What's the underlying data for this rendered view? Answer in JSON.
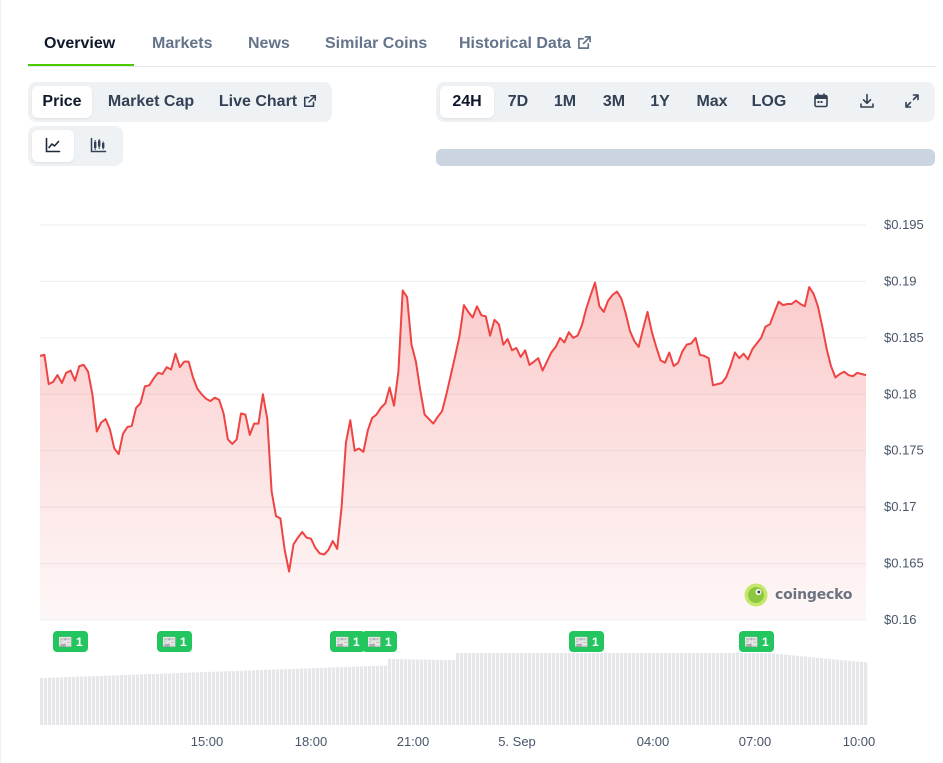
{
  "tabs": [
    {
      "label": "Overview",
      "active": true
    },
    {
      "label": "Markets"
    },
    {
      "label": "News"
    },
    {
      "label": "Similar Coins"
    },
    {
      "label": "Historical Data",
      "external": true
    }
  ],
  "chart_mode": [
    "Price",
    "Market Cap",
    "Live Chart"
  ],
  "chart_mode_active": "Price",
  "chart_style_icons": [
    "line-chart-icon",
    "candlestick-icon"
  ],
  "ranges": [
    "24H",
    "7D",
    "1M",
    "3M",
    "1Y",
    "Max",
    "LOG"
  ],
  "range_active": "24H",
  "tool_icons": [
    "calendar-icon",
    "download-icon",
    "fullscreen-icon"
  ],
  "watermark": "coingecko",
  "news_badge_count": "1",
  "colors": {
    "accent": "#4bcc00",
    "line": "#ef4444",
    "news": "#22c55e"
  },
  "chart_data": {
    "type": "area",
    "y_axis_ticks": [
      "$0.195",
      "$0.19",
      "$0.185",
      "$0.18",
      "$0.175",
      "$0.17",
      "$0.165",
      "$0.16"
    ],
    "ylim": [
      0.16,
      0.195
    ],
    "x_axis_ticks": [
      "15:00",
      "18:00",
      "21:00",
      "5. Sep",
      "04:00",
      "07:00",
      "10:00"
    ],
    "series": [
      {
        "values": [
          0.1834,
          0.1835,
          0.1809,
          0.1811,
          0.1817,
          0.181,
          0.1819,
          0.1821,
          0.1812,
          0.1825,
          0.1826,
          0.182,
          0.18,
          0.1767,
          0.1775,
          0.1778,
          0.1769,
          0.1752,
          0.1747,
          0.1765,
          0.1771,
          0.1772,
          0.1788,
          0.1792,
          0.1807,
          0.1808,
          0.1814,
          0.1819,
          0.1818,
          0.1824,
          0.1822,
          0.1836,
          0.1824,
          0.1829,
          0.1829,
          0.1815,
          0.1805,
          0.18,
          0.1796,
          0.1794,
          0.1797,
          0.1795,
          0.1783,
          0.176,
          0.1756,
          0.176,
          0.1783,
          0.1782,
          0.1764,
          0.1774,
          0.1774,
          0.18,
          0.1778,
          0.1714,
          0.1692,
          0.169,
          0.1662,
          0.1643,
          0.1667,
          0.1673,
          0.1678,
          0.1673,
          0.1672,
          0.1664,
          0.1659,
          0.1658,
          0.1662,
          0.167,
          0.1663,
          0.17,
          0.1757,
          0.1777,
          0.175,
          0.1752,
          0.1749,
          0.1768,
          0.1779,
          0.1782,
          0.1788,
          0.1792,
          0.1806,
          0.179,
          0.182,
          0.1892,
          0.1886,
          0.1844,
          0.1829,
          0.1804,
          0.1782,
          0.1778,
          0.1774,
          0.178,
          0.1785,
          0.18,
          0.1817,
          0.1834,
          0.1852,
          0.1879,
          0.1873,
          0.1868,
          0.1878,
          0.187,
          0.1869,
          0.1852,
          0.1866,
          0.1862,
          0.1844,
          0.1849,
          0.1839,
          0.1841,
          0.1833,
          0.1839,
          0.1826,
          0.1829,
          0.1832,
          0.1821,
          0.1829,
          0.1837,
          0.1842,
          0.185,
          0.1846,
          0.1855,
          0.185,
          0.1852,
          0.1861,
          0.1876,
          0.1888,
          0.1899,
          0.1878,
          0.1873,
          0.1883,
          0.1888,
          0.1891,
          0.1885,
          0.1872,
          0.1856,
          0.1847,
          0.1842,
          0.1858,
          0.1873,
          0.1855,
          0.1842,
          0.183,
          0.1828,
          0.1837,
          0.1825,
          0.1828,
          0.1838,
          0.1844,
          0.1845,
          0.185,
          0.1835,
          0.1834,
          0.1832,
          0.1808,
          0.1809,
          0.181,
          0.1815,
          0.1825,
          0.1837,
          0.1832,
          0.1836,
          0.1831,
          0.184,
          0.1845,
          0.185,
          0.186,
          0.1862,
          0.1872,
          0.1882,
          0.1879,
          0.188,
          0.188,
          0.1883,
          0.188,
          0.1878,
          0.1895,
          0.1889,
          0.1878,
          0.186,
          0.184,
          0.1825,
          0.1815,
          0.1818,
          0.182,
          0.1817,
          0.1816,
          0.1819,
          0.1818,
          0.1817
        ]
      }
    ],
    "volume_bars_relative": "shown as grey bars below the price line",
    "line_color": "#ef4444",
    "grid": true
  }
}
